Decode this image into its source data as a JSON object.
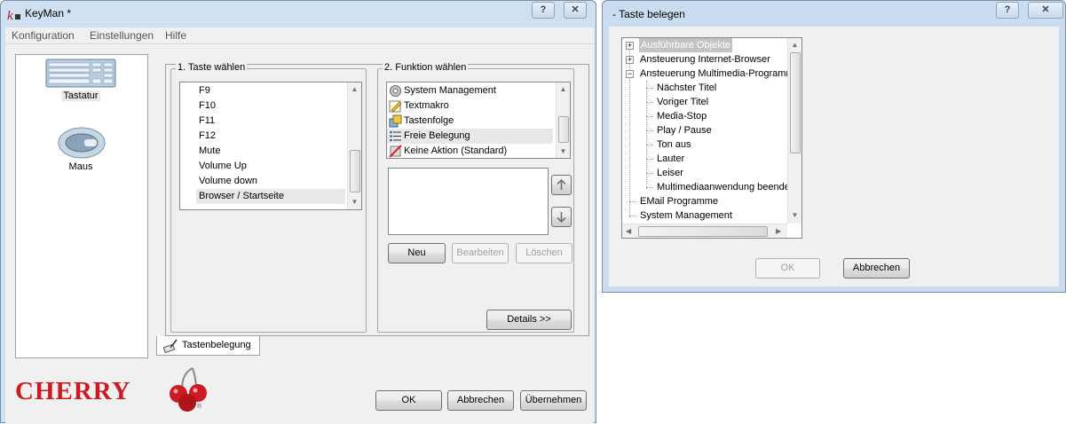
{
  "main_window": {
    "title": "KeyMan *",
    "caption_help": "?",
    "caption_close": "✕",
    "menu": [
      "Konfiguration",
      "Einstellungen",
      "Hilfe"
    ],
    "sidebar": [
      {
        "label": "Tastatur",
        "icon": "keyboard-icon",
        "selected": true
      },
      {
        "label": "Maus",
        "icon": "mouse-icon",
        "selected": false
      }
    ],
    "group1_title": "1. Taste wählen",
    "keys": [
      "F9",
      "F10",
      "F11",
      "F12",
      "Mute",
      "Volume Up",
      "Volume down",
      "Browser / Startseite"
    ],
    "keys_selected": "Browser / Startseite",
    "group2_title": "2. Funktion wählen",
    "functions": [
      {
        "label": "System Management",
        "icon": "gear-icon"
      },
      {
        "label": "Textmakro",
        "icon": "pencil-icon"
      },
      {
        "label": "Tastenfolge",
        "icon": "keys-icon"
      },
      {
        "label": "Freie Belegung",
        "icon": "list-icon"
      },
      {
        "label": "Keine Aktion (Standard)",
        "icon": "no-action-icon"
      }
    ],
    "functions_selected": "Freie Belegung",
    "buttons": {
      "neu": "Neu",
      "bearbeiten": "Bearbeiten",
      "loeschen": "Löschen",
      "details": "Details >>"
    },
    "tab_label": "Tastenbelegung",
    "brand": "CHERRY",
    "brand_mark": "®",
    "brand_color": "#cc1b22",
    "bottom_buttons": {
      "ok": "OK",
      "abbrechen": "Abbrechen",
      "uebernehmen": "Übernehmen"
    }
  },
  "dialog": {
    "title": "- Taste belegen",
    "caption_help": "?",
    "caption_close": "✕",
    "tree": [
      {
        "label": "Ausführbare Objekte",
        "level": 0,
        "expander": "+",
        "selected": true
      },
      {
        "label": "Ansteuerung Internet-Browser",
        "level": 0,
        "expander": "+"
      },
      {
        "label": "Ansteuerung Multimedia-Programme",
        "level": 0,
        "expander": "−"
      },
      {
        "label": "Nächster Titel",
        "level": 1
      },
      {
        "label": "Voriger Titel",
        "level": 1
      },
      {
        "label": "Media-Stop",
        "level": 1
      },
      {
        "label": "Play / Pause",
        "level": 1
      },
      {
        "label": "Ton aus",
        "level": 1
      },
      {
        "label": "Lauter",
        "level": 1
      },
      {
        "label": "Leiser",
        "level": 1
      },
      {
        "label": "Multimediaanwendung beenden",
        "level": 1
      },
      {
        "label": "EMail Programme",
        "level": 0
      },
      {
        "label": "System Management",
        "level": 0
      }
    ],
    "ok": "OK",
    "abbrechen": "Abbrechen"
  }
}
